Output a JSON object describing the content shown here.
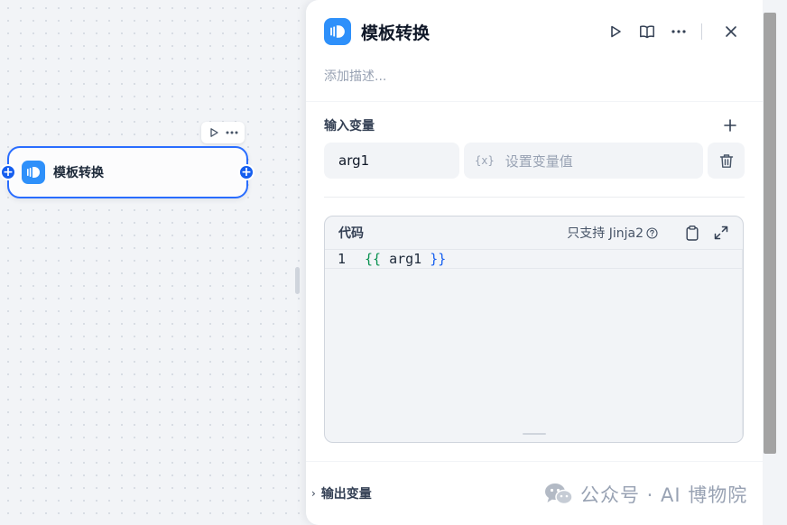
{
  "canvas": {
    "node": {
      "title": "模板转换",
      "toolbar": {
        "run_icon": "play-icon",
        "more_icon": "more-icon"
      }
    },
    "handles": {
      "left": "+",
      "right": "+"
    }
  },
  "panel": {
    "title": "模板转换",
    "description_placeholder": "添加描述...",
    "header_actions": [
      "play-icon",
      "book-icon",
      "more-icon",
      "close-icon"
    ],
    "input_vars": {
      "label": "输入变量",
      "add_icon": "plus-icon",
      "rows": [
        {
          "name": "arg1",
          "value_prefix": "{x}",
          "value_placeholder": "设置变量值"
        }
      ]
    },
    "code": {
      "label": "代码",
      "note": "只支持 Jinja2",
      "lines": [
        {
          "no": "1",
          "open": "{{",
          "body": " arg1 ",
          "close": "}}"
        }
      ]
    },
    "output_vars": {
      "label": "输出变量",
      "chevron": "›"
    }
  },
  "watermark": {
    "text": "公众号 · AI 博物院"
  },
  "colors": {
    "accent": "#296dff",
    "node_icon": "#2e90fa",
    "handle": "#155eef"
  }
}
